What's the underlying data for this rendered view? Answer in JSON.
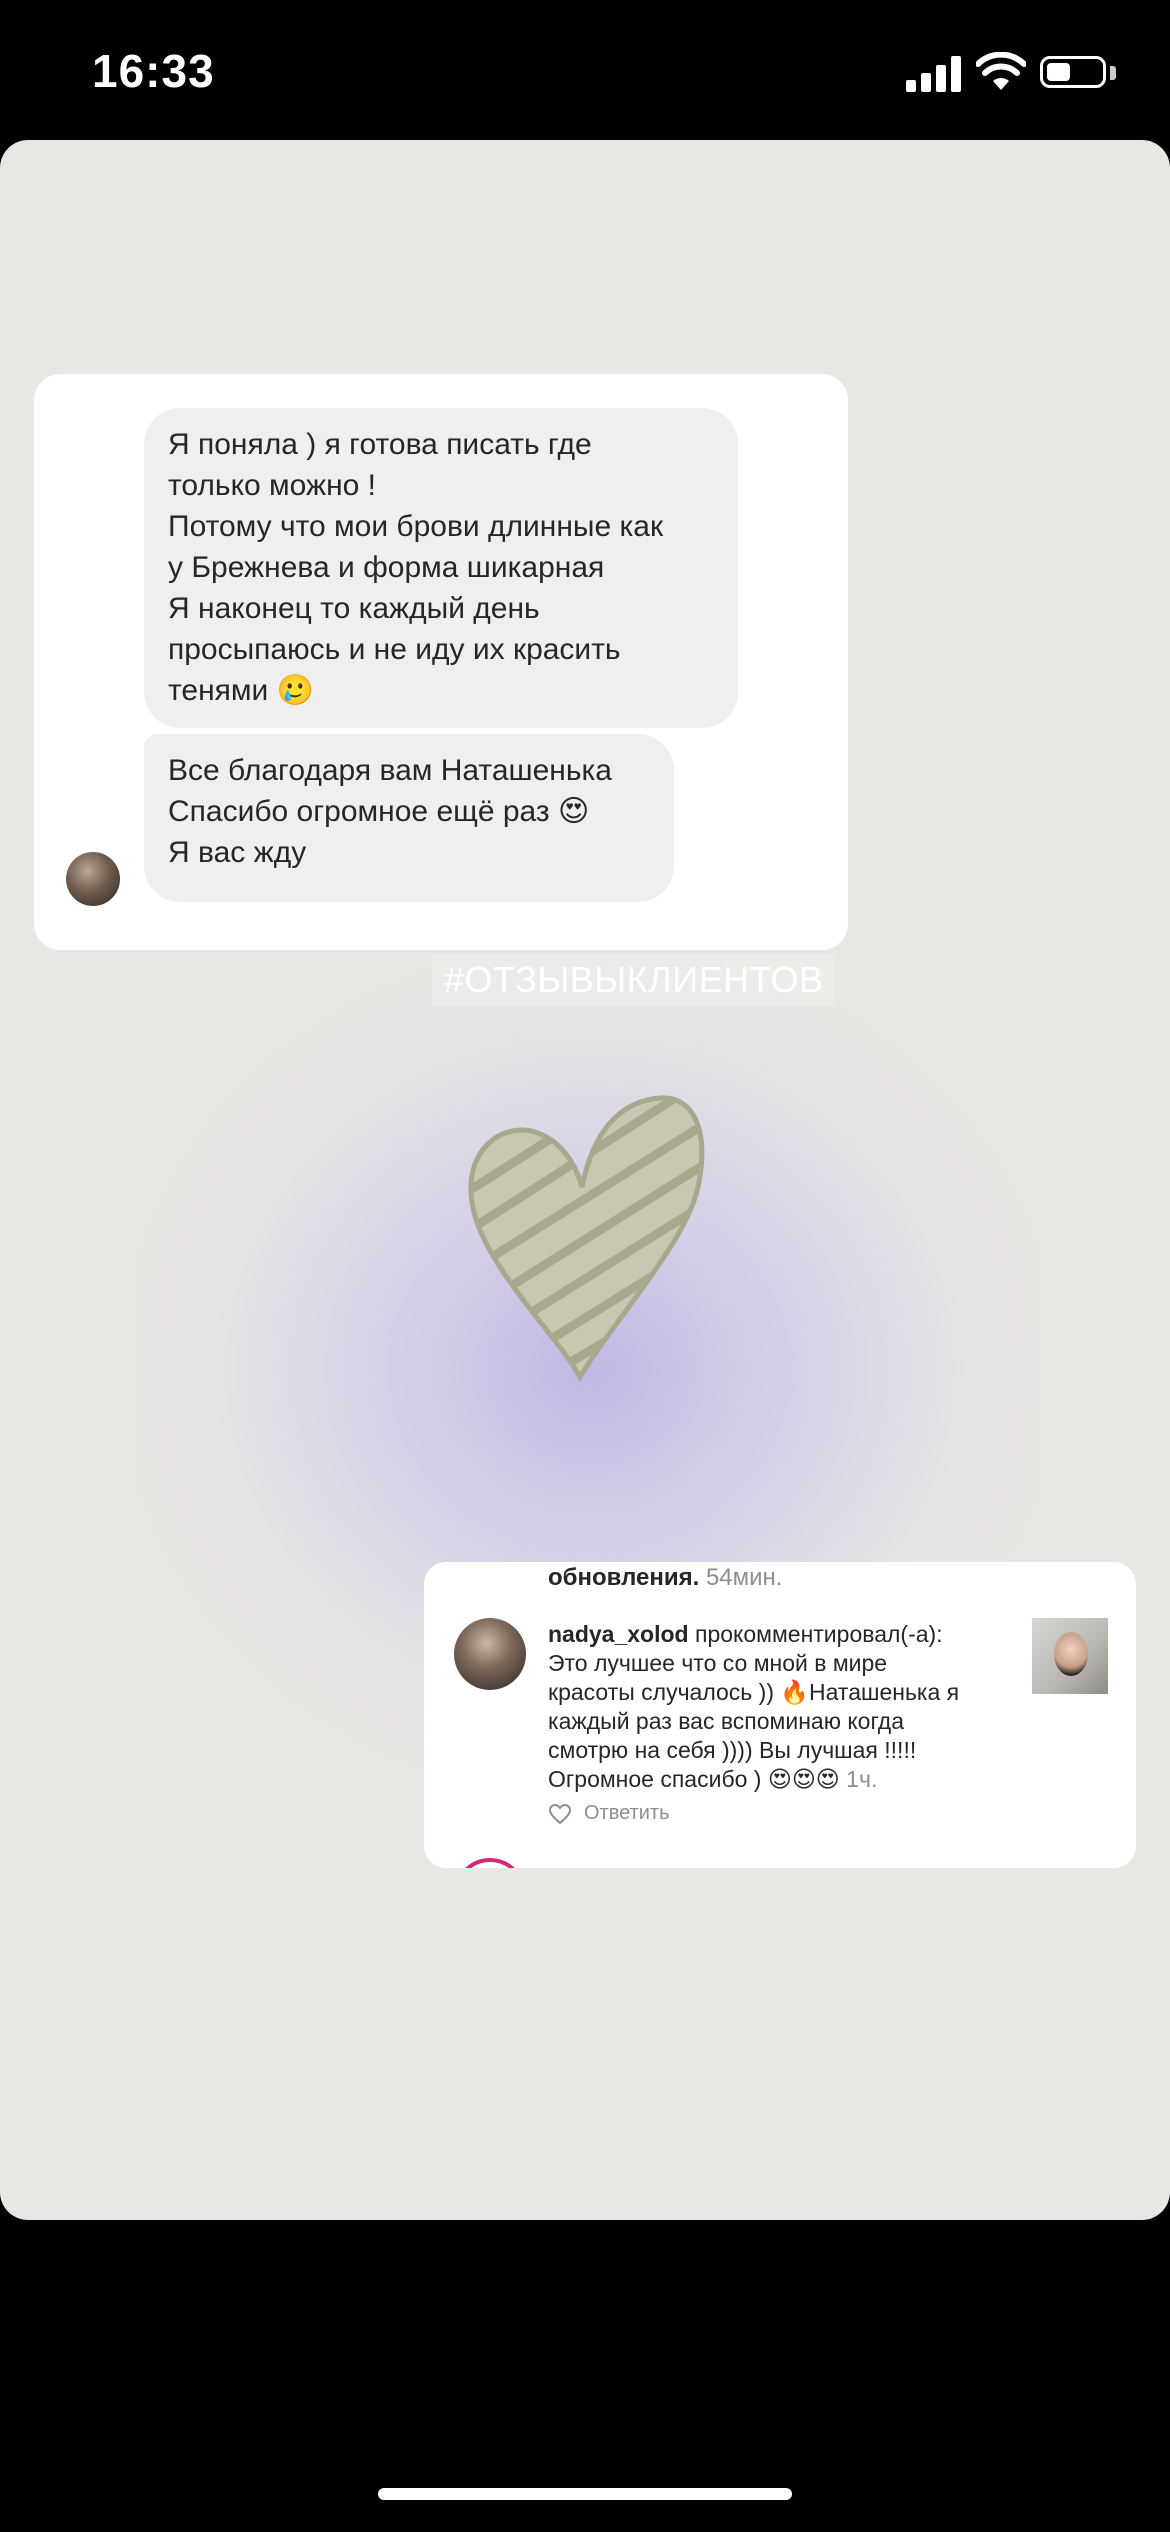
{
  "status_bar": {
    "time": "16:33",
    "battery_level": 0.45
  },
  "chat": {
    "messages": [
      "Я поняла ) я готова писать где\nтолько можно !\nПотому что мои брови длинные как\nу Брежнева и форма шикарная\nЯ наконец то каждый день\nпросыпаюсь и не иду их красить\nтенями 🥲",
      "Все благодаря вам Наташенька\nСпасибо огромное ещё раз 😍\nЯ вас жду"
    ]
  },
  "hashtag": "#ОТЗЫВЫКЛИЕНТОВ",
  "comment": {
    "prev_text": "обновления.",
    "prev_age": "54мин.",
    "username": "nadya_xolod",
    "action": "прокомментировал(-а):",
    "body": "Это лучшее что со мной в мире\nкрасоты случалось )) 🔥Наташенька я\nкаждый раз вас вспоминаю когда\nсмотрю на себя )))) Вы лучшая !!!!!\nОгромное спасибо ) 😍😍😍 ",
    "age": "1ч.",
    "reply_label": "Ответить"
  },
  "colors": {
    "story_background": "#e9e7e3",
    "glow": "#bab0e6",
    "heart": "#b5b39a",
    "bubble": "#efefef",
    "story_ring": "#d62976"
  },
  "icons": [
    "signal-icon",
    "wifi-icon",
    "battery-icon",
    "heart-sticker-icon",
    "like-heart-icon"
  ]
}
